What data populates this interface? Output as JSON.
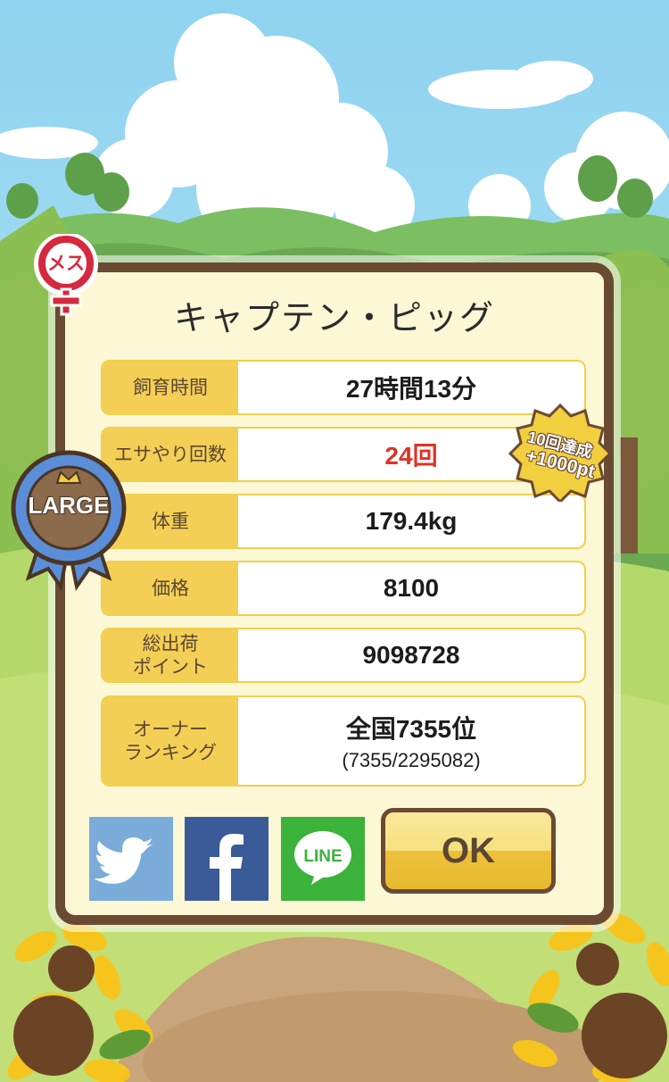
{
  "title": "キャプテン・ピッグ",
  "gender_badge": {
    "label": "メス",
    "icon": "female-symbol-icon"
  },
  "size_ribbon": {
    "label": "LARGE",
    "icon": "crown-icon"
  },
  "bonus_badge": {
    "line1": "10回達成",
    "line2": "+1000pt"
  },
  "stats": {
    "raising_time": {
      "label": "飼育時間",
      "value": "27時間13分"
    },
    "feed_count": {
      "label": "エサやり回数",
      "value": "24回"
    },
    "weight": {
      "label": "体重",
      "value": "179.4kg"
    },
    "price": {
      "label": "価格",
      "value": "8100"
    },
    "shipping_points": {
      "label": "総出荷\nポイント",
      "value": "9098728"
    },
    "owner_ranking": {
      "label": "オーナー\nランキング",
      "value": "全国7355位",
      "detail": "(7355/2295082)"
    }
  },
  "share": {
    "twitter": {
      "icon": "twitter-bird-icon",
      "color": "#7aabd9"
    },
    "facebook": {
      "icon": "facebook-f-icon",
      "color": "#3b5a98"
    },
    "line": {
      "label": "LINE",
      "icon": "line-logo-icon",
      "color": "#3bb23a"
    }
  },
  "ok_label": "OK",
  "colors": {
    "frame": "#6b4a34",
    "panel": "#fcf8d6",
    "label_bg": "#f4cf55",
    "highlight_red": "#e03226"
  }
}
